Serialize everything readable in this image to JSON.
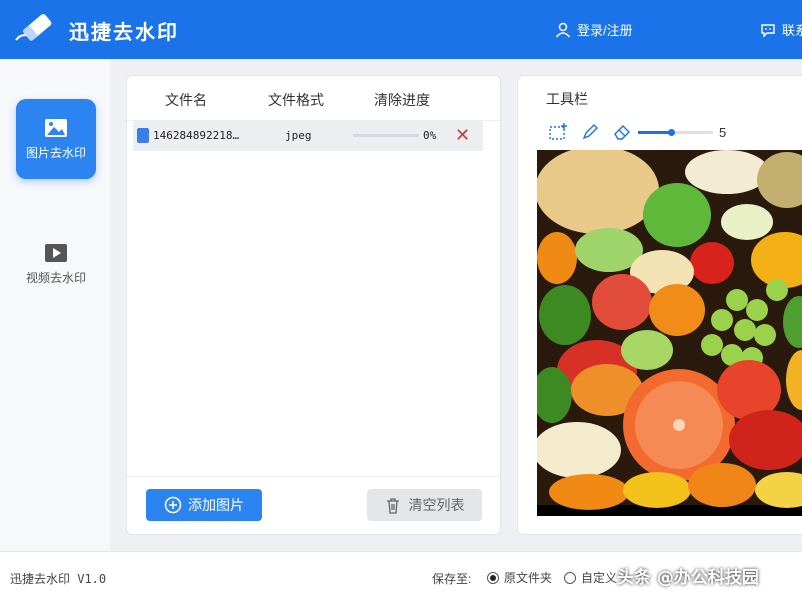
{
  "header": {
    "title": "迅捷去水印",
    "login_label": "登录/注册",
    "contact_label": "联系"
  },
  "sidebar": {
    "items": [
      {
        "label": "图片去水印",
        "icon": "image-icon",
        "active": true
      },
      {
        "label": "视频去水印",
        "icon": "video-play-icon",
        "active": false
      }
    ]
  },
  "file_list": {
    "columns": [
      "文件名",
      "文件格式",
      "清除进度"
    ],
    "rows": [
      {
        "name": "146284892218…",
        "format": "jpeg",
        "progress_label": "0%",
        "progress": 0
      }
    ],
    "add_label": "添加图片",
    "clear_label": "清空列表"
  },
  "toolbar": {
    "title": "工具栏",
    "tools": [
      "rect-select-icon",
      "brush-icon",
      "eraser-icon"
    ],
    "brush_size": "5",
    "brush_size_fraction": 0.4
  },
  "status": {
    "version": "迅捷去水印 V1.0",
    "save_to_label": "保存至:",
    "options": [
      {
        "label": "原文件夹",
        "selected": true
      },
      {
        "label": "自定义",
        "selected": false
      }
    ],
    "watermark": "头条 @办公科技园"
  },
  "colors": {
    "accent": "#1a73e8",
    "danger": "#dd3333"
  }
}
